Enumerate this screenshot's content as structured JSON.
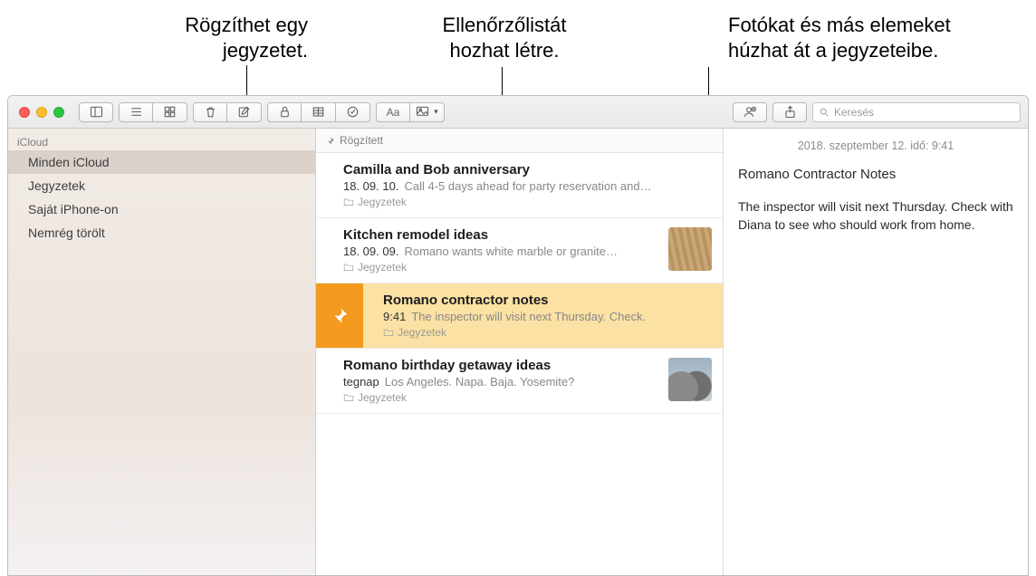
{
  "callouts": {
    "left": "Rögzíthet egy\njegyzetet.",
    "center": "Ellenőrzőlistát\nhozhat létre.",
    "right": "Fotókat és más elemeket\nhúzhat át a jegyzeteibe."
  },
  "search": {
    "placeholder": "Keresés"
  },
  "sidebar": {
    "account": "iCloud",
    "items": [
      "Minden iCloud",
      "Jegyzetek",
      "Saját iPhone-on",
      "Nemrég törölt"
    ],
    "selected": 0
  },
  "noteList": {
    "sectionLabel": "Rögzített",
    "folderLabel": "Jegyzetek",
    "items": [
      {
        "title": "Camilla and Bob anniversary",
        "date": "18. 09. 10.",
        "snippet": "Call 4-5 days ahead for party reservation and…",
        "thumb": null,
        "selected": false
      },
      {
        "title": "Kitchen remodel ideas",
        "date": "18. 09. 09.",
        "snippet": "Romano wants white marble or granite…",
        "thumb": "wood",
        "selected": false
      },
      {
        "title": "Romano contractor notes",
        "date": "9:41",
        "snippet": "The inspector will visit next Thursday. Check.",
        "thumb": null,
        "selected": true
      },
      {
        "title": "Romano birthday getaway ideas",
        "date": "tegnap",
        "snippet": "Los Angeles. Napa. Baja. Yosemite?",
        "thumb": "rocks",
        "selected": false
      }
    ]
  },
  "detail": {
    "timestamp": "2018. szeptember 12. idő: 9:41",
    "title": "Romano Contractor Notes",
    "body": "The inspector will visit next Thursday. Check with Diana to see who should work from home."
  }
}
